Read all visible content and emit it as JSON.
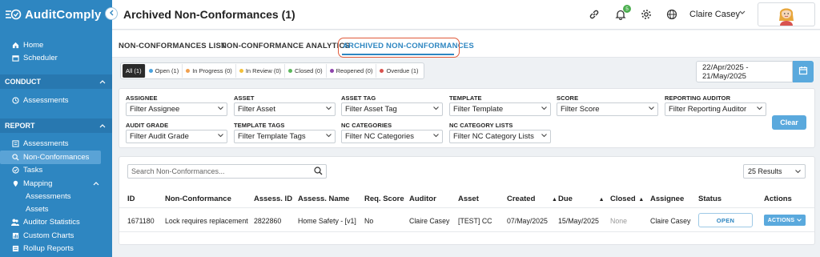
{
  "app": {
    "name": "AuditComply"
  },
  "sidebar": {
    "top_items": [
      {
        "label": "Home",
        "icon": "home-icon"
      },
      {
        "label": "Scheduler",
        "icon": "calendar-icon"
      }
    ],
    "conduct": {
      "label": "CONDUCT",
      "items": [
        {
          "label": "Assessments",
          "icon": "clock-icon"
        }
      ]
    },
    "report": {
      "label": "REPORT",
      "items": [
        {
          "label": "Assessments",
          "icon": "list-icon"
        },
        {
          "label": "Non-Conformances",
          "icon": "search-doc-icon"
        },
        {
          "label": "Tasks",
          "icon": "check-icon"
        },
        {
          "label": "Mapping",
          "icon": "map-pin-icon"
        }
      ],
      "mapping_sub": [
        "Assessments",
        "Assets"
      ],
      "more_items": [
        {
          "label": "Auditor Statistics",
          "icon": "users-icon"
        },
        {
          "label": "Custom Charts",
          "icon": "chart-icon"
        },
        {
          "label": "Rollup Reports",
          "icon": "report-icon"
        }
      ]
    }
  },
  "header": {
    "title": "Archived Non-Conformances (1)",
    "notification_count": "5",
    "user_name": "Claire Casey"
  },
  "tabs": [
    "NON-CONFORMANCES LIST",
    "NON-CONFORMANCE ANALYTICS",
    "ARCHIVED NON-CONFORMANCES"
  ],
  "status_chips": [
    {
      "label": "All (1)",
      "color": ""
    },
    {
      "label": "Open (1)",
      "color": "#4aa3df"
    },
    {
      "label": "In Progress (0)",
      "color": "#f0a050"
    },
    {
      "label": "In Review (0)",
      "color": "#f3c13a"
    },
    {
      "label": "Closed (0)",
      "color": "#5cb85c"
    },
    {
      "label": "Reopened (0)",
      "color": "#8e44ad"
    },
    {
      "label": "Overdue (1)",
      "color": "#d9534f"
    }
  ],
  "date_range": "22/Apr/2025 - 21/May/2025",
  "filters": {
    "assignee": {
      "label": "ASSIGNEE",
      "value": "Filter Assignee"
    },
    "asset": {
      "label": "ASSET",
      "value": "Filter Asset"
    },
    "asset_tag": {
      "label": "ASSET TAG",
      "value": "Filter Asset Tag"
    },
    "template": {
      "label": "TEMPLATE",
      "value": "Filter Template"
    },
    "score": {
      "label": "SCORE",
      "value": "Filter Score"
    },
    "reporting_auditor": {
      "label": "REPORTING AUDITOR",
      "value": "Filter Reporting Auditor"
    },
    "audit_grade": {
      "label": "AUDIT GRADE",
      "value": "Filter Audit Grade"
    },
    "template_tags": {
      "label": "TEMPLATE TAGS",
      "value": "Filter Template Tags"
    },
    "nc_categories": {
      "label": "NC CATEGORIES",
      "value": "Filter NC Categories"
    },
    "nc_category_lists": {
      "label": "NC CATEGORY LISTS",
      "value": "Filter NC Category Lists"
    },
    "clear_label": "Clear"
  },
  "table": {
    "search_placeholder": "Search Non-Conformances...",
    "results_per_page": "25 Results",
    "columns": [
      "ID",
      "Non-Conformance",
      "Assess. ID",
      "Assess. Name",
      "Req. Score",
      "Auditor",
      "Asset",
      "Created",
      "Due",
      "Closed",
      "Assignee",
      "Status",
      "Actions"
    ],
    "rows": [
      {
        "id": "1671180",
        "non_conformance": "Lock requires replacement",
        "assess_id": "2822860",
        "assess_name": "Home Safety - [v1]",
        "req_score": "No",
        "auditor": "Claire Casey",
        "asset": "[TEST] CC",
        "created": "07/May/2025",
        "due": "15/May/2025",
        "closed": "None",
        "assignee": "Claire Casey",
        "status": "OPEN",
        "actions": "ACTIONS"
      }
    ]
  }
}
